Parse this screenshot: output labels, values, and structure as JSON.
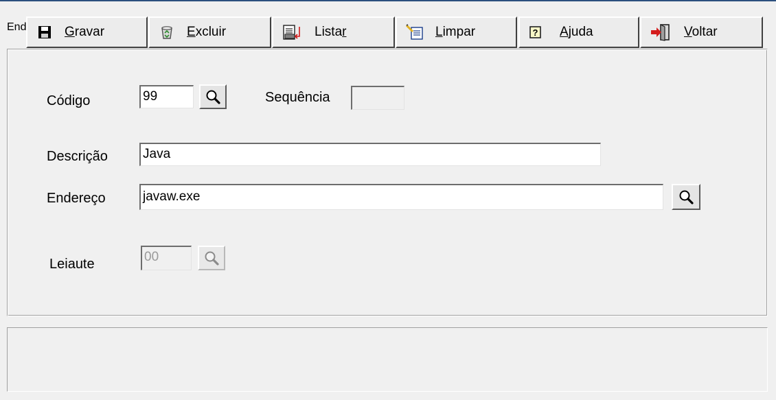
{
  "window": {
    "title": "Endereço dos Arquivos"
  },
  "form": {
    "codigo": {
      "label": "Código",
      "value": "99"
    },
    "sequencia": {
      "label": "Sequência",
      "value": ""
    },
    "descricao": {
      "label": "Descrição",
      "value": "Java"
    },
    "endereco": {
      "label": "Endereço",
      "value": "javaw.exe"
    },
    "leiaute": {
      "label": "Leiaute",
      "value": "00",
      "enabled": false
    }
  },
  "toolbar": {
    "buttons": [
      {
        "label_pre": "",
        "mnemonic": "G",
        "label_post": "ravar",
        "icon": "floppy-disk-icon"
      },
      {
        "label_pre": "",
        "mnemonic": "E",
        "label_post": "xcluir",
        "icon": "recycle-bin-icon"
      },
      {
        "label_pre": "Lista",
        "mnemonic": "r",
        "label_post": "",
        "icon": "printer-list-icon"
      },
      {
        "label_pre": "",
        "mnemonic": "L",
        "label_post": "impar",
        "icon": "clear-pencil-icon"
      },
      {
        "label_pre": "",
        "mnemonic": "A",
        "label_post": "juda",
        "icon": "help-icon"
      },
      {
        "label_pre": "",
        "mnemonic": "V",
        "label_post": "oltar",
        "icon": "exit-door-icon"
      }
    ]
  }
}
